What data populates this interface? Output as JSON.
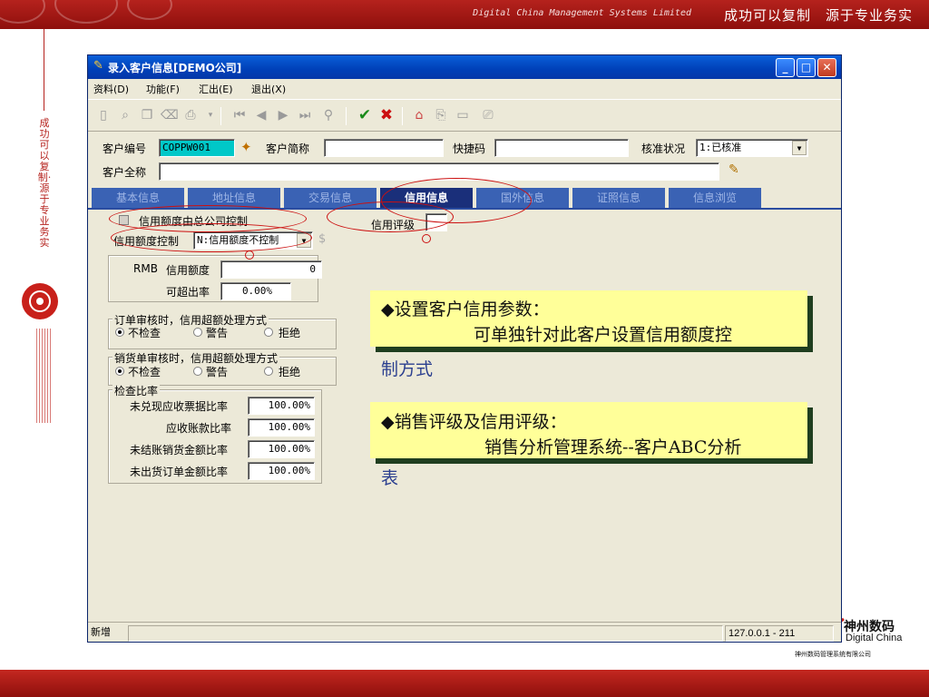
{
  "slide": {
    "company_en": "Digital China Management Systems Limited",
    "slogan": "成功可以复制　源于专业务实",
    "side_text": "成功可以复制·源于专业务实",
    "logo_cn": "神州数码",
    "logo_en": "Digital China",
    "logo_full": "神州数码管理系统有限公司"
  },
  "window": {
    "title": "录入客户信息[DEMO公司]",
    "controls": [
      "_",
      "□",
      "✕"
    ]
  },
  "menu": [
    "资料(D)",
    "功能(F)",
    "汇出(E)",
    "退出(X)"
  ],
  "toolbar": {
    "icons": [
      "new-doc-icon",
      "preview-icon",
      "copy-icon",
      "delete-icon",
      "print-icon",
      "first-icon",
      "prev-icon",
      "next-icon",
      "last-icon",
      "find-icon",
      "confirm-icon",
      "cancel-icon",
      "home-icon",
      "attach-icon",
      "image-icon",
      "report-icon"
    ]
  },
  "header": {
    "code_label": "客户编号",
    "code_value": "COPPW001",
    "short_label": "客户简称",
    "short_value": "",
    "quick_label": "快捷码",
    "quick_value": "",
    "approve_label": "核准状况",
    "approve_value": "1:已核准",
    "fullname_label": "客户全称",
    "fullname_value": ""
  },
  "tabs": [
    "基本信息",
    "地址信息",
    "交易信息",
    "信用信息",
    "国外信息",
    "证照信息",
    "信息浏览"
  ],
  "active_tab": "信用信息",
  "credit": {
    "hq_control_label": "信用额度由总公司控制",
    "limit_control_label": "信用额度控制",
    "limit_control_value": "N:信用额度不控制",
    "currency": "RMB",
    "limit_label": "信用额度",
    "limit_value": "0",
    "overrun_label": "可超出率",
    "overrun_value": "0.00%",
    "rating_label": "信用评级",
    "rating_value": "",
    "order_group": "订单审核时，信用超额处理方式",
    "sales_group": "销货单审核时，信用超额处理方式",
    "options": [
      "不检查",
      "警告",
      "拒绝"
    ],
    "check_group": "检查比率",
    "ratios": [
      {
        "label": "未兑现应收票据比率",
        "value": "100.00%"
      },
      {
        "label": "应收账款比率",
        "value": "100.00%"
      },
      {
        "label": "未结账销货金额比率",
        "value": "100.00%"
      },
      {
        "label": "未出货订单金额比率",
        "value": "100.00%"
      }
    ]
  },
  "status": {
    "mode": "新增",
    "host": "127.0.0.1 - 211"
  },
  "notes": [
    {
      "line1": "◆设置客户信用参数：",
      "line2": "可单独针对此客户设置信用额度控",
      "overflow": "制方式"
    },
    {
      "line1": "◆销售评级及信用评级：",
      "line2": "销售分析管理系统--客户ABC分析",
      "overflow": "表"
    }
  ]
}
